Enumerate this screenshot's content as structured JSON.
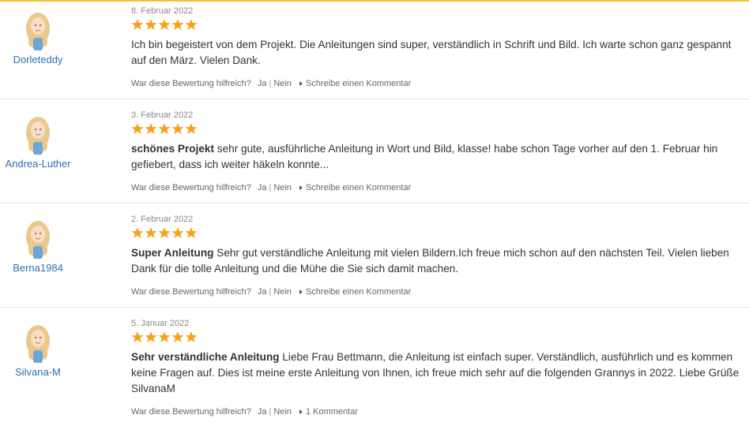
{
  "colors": {
    "star": "#f7a21b",
    "username": "#2f6fb0",
    "accent": "#f2c037"
  },
  "reviews": [
    {
      "user": "Dorleteddy",
      "date": "8. Februar 2022",
      "rating": 5,
      "title": "",
      "text": "Ich bin begeistert von dem Projekt. Die Anleitungen sind super, verständlich in Schrift und Bild. Ich warte schon ganz gespannt auf den März. Vielen Dank.",
      "helpful_label": "War diese Bewertung hilfreich?",
      "yes": "Ja",
      "no": "Nein",
      "comment_link": "Schreibe einen Kommentar"
    },
    {
      "user": "Andrea-Luther",
      "date": "3. Februar 2022",
      "rating": 5,
      "title": "schönes Projekt",
      "text": "sehr gute, ausführliche Anleitung in Wort und Bild, klasse! habe schon Tage vorher auf den 1. Februar hin gefiebert, dass ich weiter häkeln konnte...",
      "helpful_label": "War diese Bewertung hilfreich?",
      "yes": "Ja",
      "no": "Nein",
      "comment_link": "Schreibe einen Kommentar"
    },
    {
      "user": "Berna1984",
      "date": "2. Februar 2022",
      "rating": 5,
      "title": "Super Anleitung",
      "text": "Sehr gut verständliche Anleitung mit vielen Bildern.Ich freue mich schon auf den nächsten Teil. Vielen lieben Dank für die tolle Anleitung und die Mühe die Sie sich damit machen.",
      "helpful_label": "War diese Bewertung hilfreich?",
      "yes": "Ja",
      "no": "Nein",
      "comment_link": "Schreibe einen Kommentar"
    },
    {
      "user": "Silvana-M",
      "date": "5. Januar 2022",
      "rating": 5,
      "title": "Sehr verständliche Anleitung",
      "text": "Liebe Frau Bettmann, die Anleitung ist einfach super. Verständlich, ausführlich und es kommen keine Fragen auf. Dies ist meine erste Anleitung von Ihnen, ich freue mich sehr auf die folgenden Grannys in 2022. Liebe Grüße SilvanaM",
      "helpful_label": "War diese Bewertung hilfreich?",
      "yes": "Ja",
      "no": "Nein",
      "comment_link": "1 Kommentar"
    }
  ]
}
